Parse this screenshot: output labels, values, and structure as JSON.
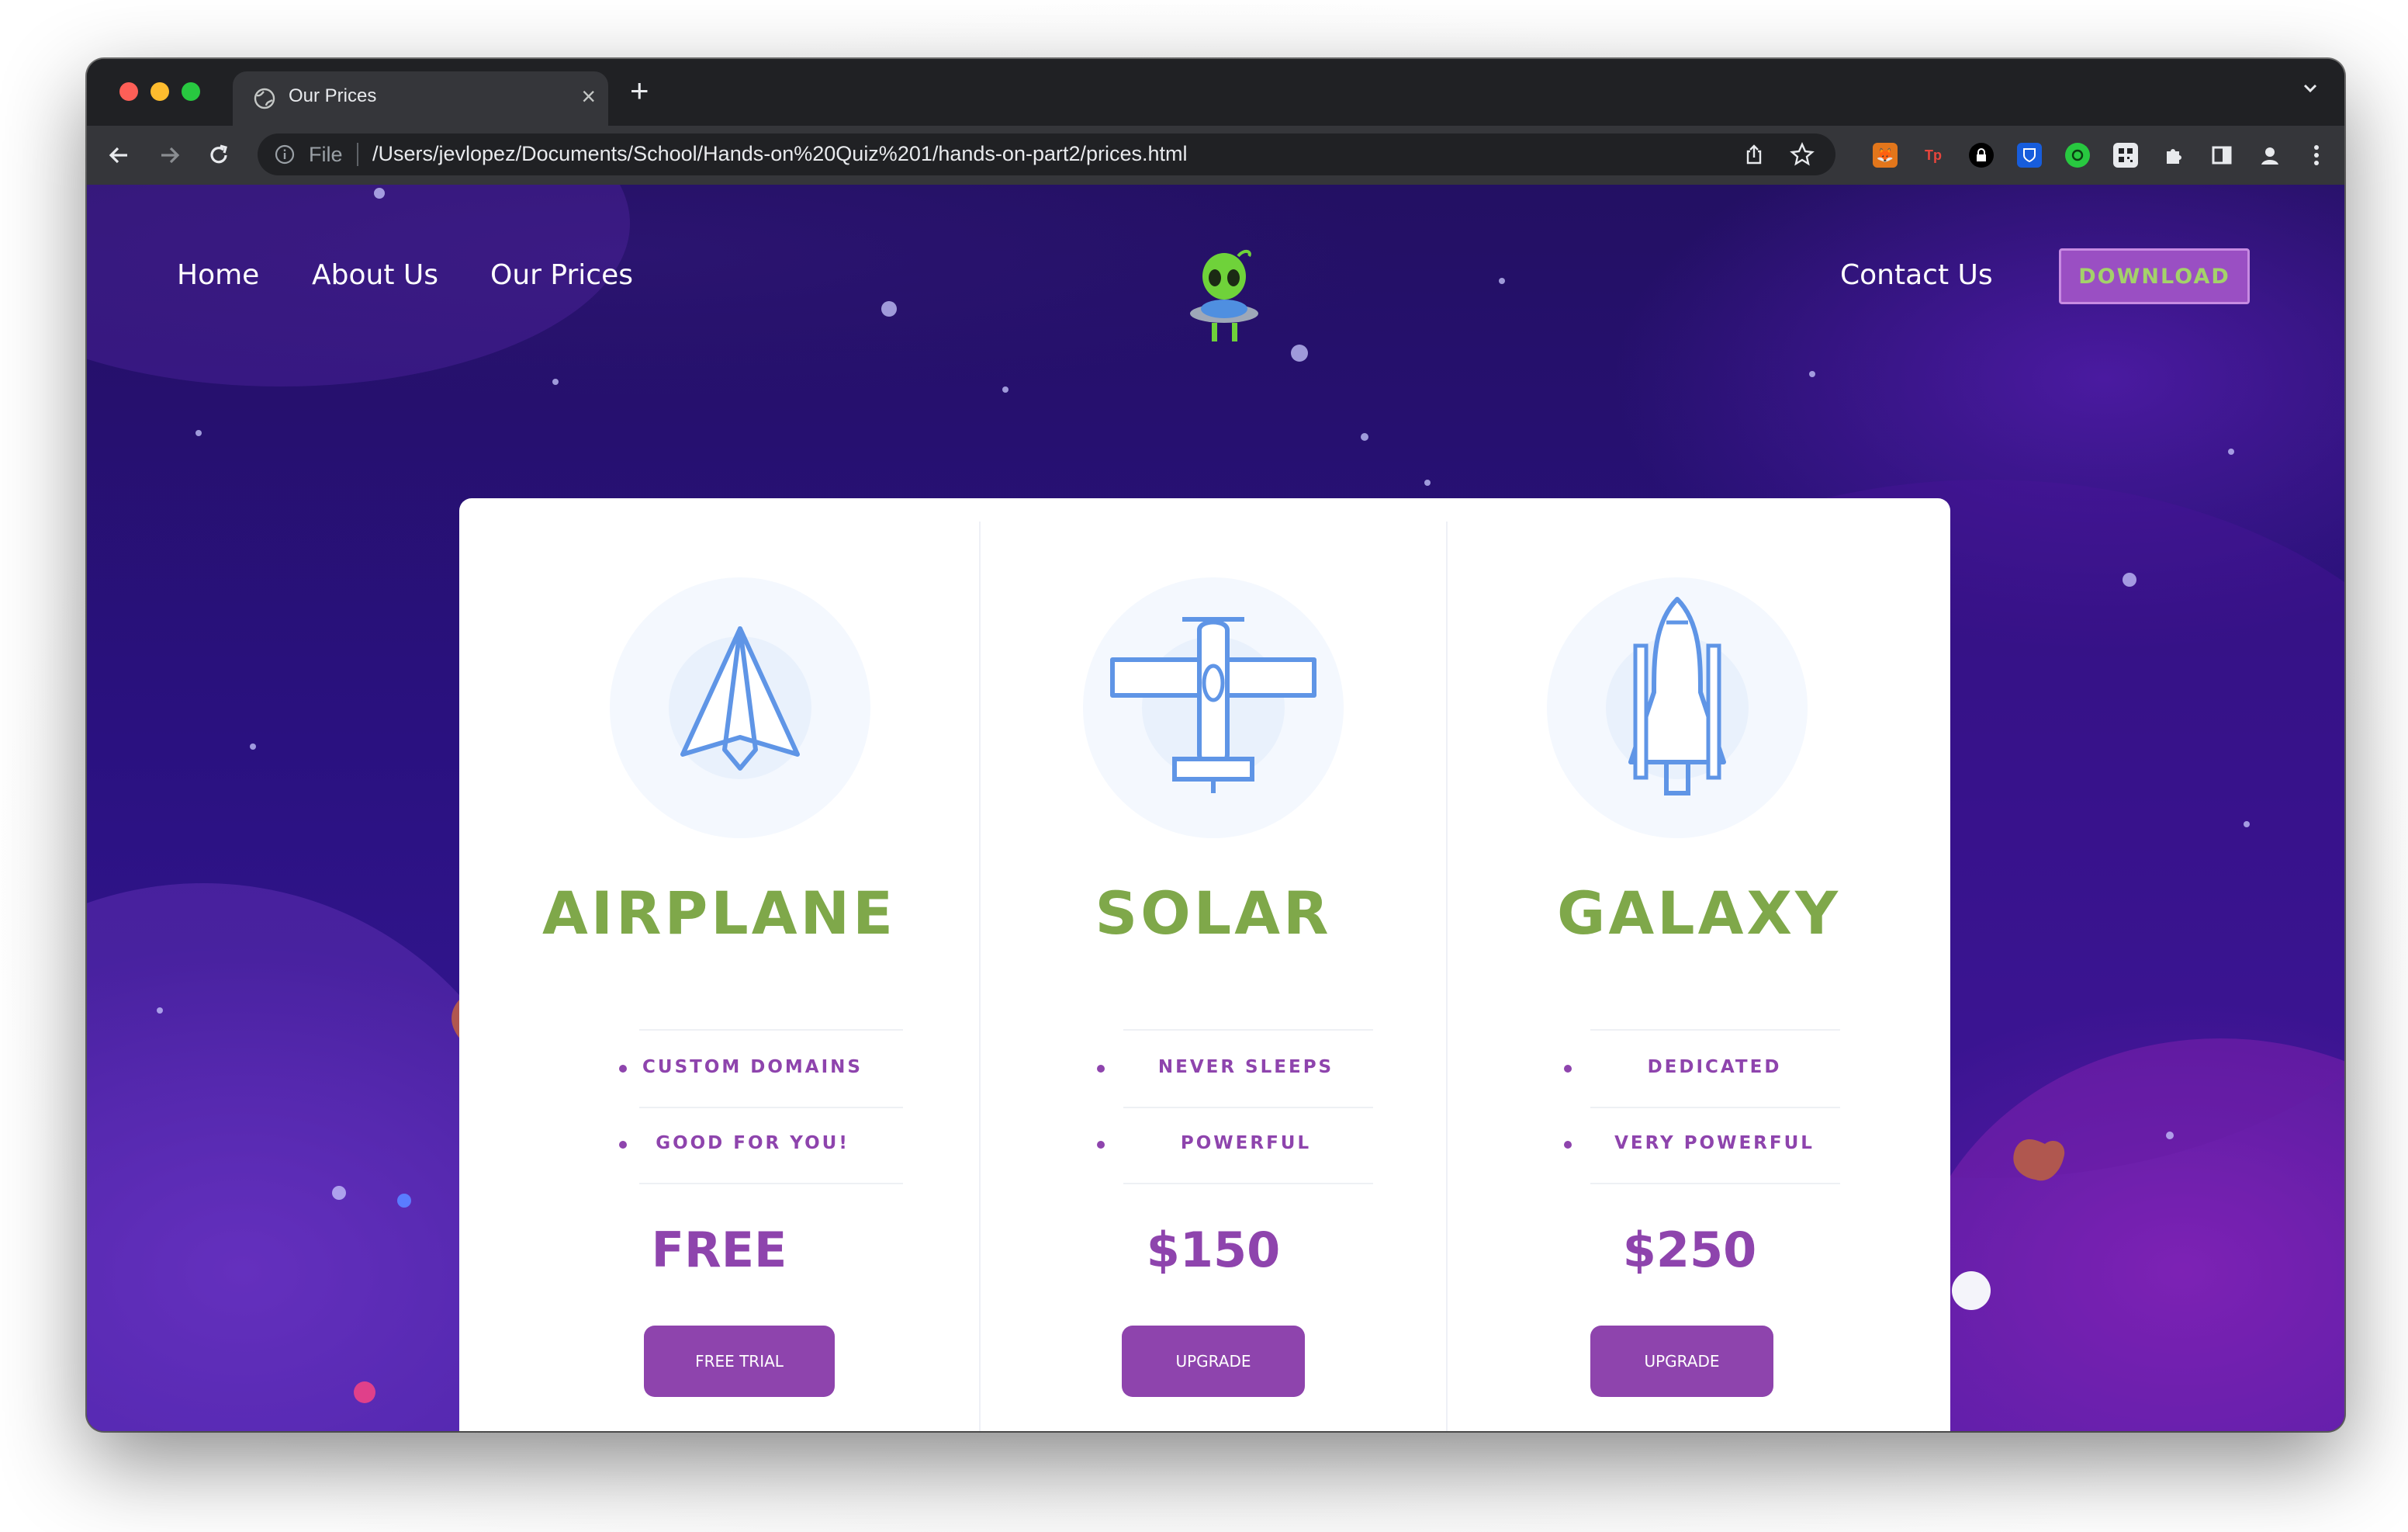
{
  "browser": {
    "tab_title": "Our Prices",
    "new_tab_label": "+",
    "omnibox_scheme": "File",
    "url": "/Users/jevlopez/Documents/School/Hands-on%20Quiz%201/hands-on-part2/prices.html",
    "extensions": [
      "metamask-icon",
      "tp-icon",
      "lock-icon",
      "bitwarden-icon",
      "green-ext-icon",
      "qr-icon",
      "puzzle-icon",
      "sidepanel-icon",
      "profile-icon",
      "menu-icon"
    ],
    "extension_tp_label": "Tp"
  },
  "nav": {
    "home": "Home",
    "about": "About Us",
    "prices": "Our Prices",
    "contact": "Contact Us",
    "download": "DOWNLOAD"
  },
  "plans": [
    {
      "name": "AIRPLANE",
      "icon": "paper-plane-icon",
      "features": [
        "CUSTOM DOMAINS",
        "GOOD FOR YOU!"
      ],
      "price": "FREE",
      "button": "FREE TRIAL"
    },
    {
      "name": "SOLAR",
      "icon": "propeller-plane-icon",
      "features": [
        "NEVER SLEEPS",
        "POWERFUL"
      ],
      "price": "$150",
      "button": "UPGRADE"
    },
    {
      "name": "GALAXY",
      "icon": "space-shuttle-icon",
      "features": [
        "DEDICATED",
        "VERY POWERFUL"
      ],
      "price": "$250",
      "button": "UPGRADE"
    }
  ],
  "colors": {
    "accent_purple": "#8e44ad",
    "plan_green": "#7fa84a",
    "download_bg": "#9a4fc3",
    "download_text": "#a4d26a",
    "background": "#2a1180"
  }
}
